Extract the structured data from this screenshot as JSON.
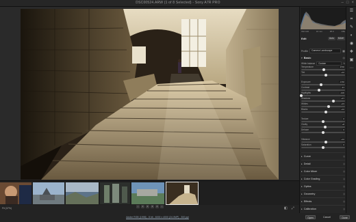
{
  "window": {
    "title": "DSC00524.ARW (1 of 8 Selected)  -  Sony A7R PRO",
    "minimize": "–",
    "maximize": "□",
    "close": "×"
  },
  "panel": {
    "camera_info": [
      "ISO 100",
      "16 mm",
      "f/8.0",
      "1/8s"
    ],
    "edit_label": "Edit",
    "auto_label": "Auto",
    "bw_label": "B&W",
    "profile_label": "Profile",
    "profile_value": "Camera Landscape",
    "basic_label": "Basic",
    "white_balance_label": "White balance",
    "white_balance_value": "Custom",
    "sliders": [
      {
        "name": "Temperature",
        "value": "4700",
        "pos": 0.52
      },
      {
        "name": "Tint",
        "value": "+12",
        "pos": 0.56
      },
      {
        "name": "Exposure",
        "value": "-0.50",
        "pos": 0.45
      },
      {
        "name": "Contrast",
        "value": "-21",
        "pos": 0.4
      },
      {
        "name": "Highlights",
        "value": "-100",
        "pos": 0.0
      },
      {
        "name": "Shadows",
        "value": "+47",
        "pos": 0.74
      },
      {
        "name": "Whites",
        "value": "+23",
        "pos": 0.62
      },
      {
        "name": "Blacks",
        "value": "+12",
        "pos": 0.56
      },
      {
        "name": "Texture",
        "value": "0",
        "pos": 0.5
      },
      {
        "name": "Clarity",
        "value": "+8",
        "pos": 0.54
      },
      {
        "name": "Dehaze",
        "value": "0",
        "pos": 0.5
      },
      {
        "name": "Vibrance",
        "value": "+12",
        "pos": 0.56
      },
      {
        "name": "Saturation",
        "value": "0",
        "pos": 0.5
      }
    ],
    "sections": [
      "Curve",
      "Detail",
      "Color Mixer",
      "Color Grading",
      "Optics",
      "Geometry",
      "Effects",
      "Calibration"
    ]
  },
  "filmstrip": {
    "nav": [
      "‹",
      "1",
      "2",
      "3",
      "4",
      "›"
    ]
  },
  "bottom": {
    "zoom": "Fit (37%)",
    "metadata_link": "Adobe RGB (1998) - 8 bit - 6000 x 4000 (24.0MP) - 300 ppi",
    "open_label": "Open",
    "cancel_label": "Cancel",
    "done_label": "Done"
  },
  "tools": [
    "edit-sliders-icon",
    "crop-icon",
    "heal-icon",
    "mask-icon",
    "redeye-icon",
    "presets-icon",
    "snapshot-icon",
    "more-icon"
  ]
}
